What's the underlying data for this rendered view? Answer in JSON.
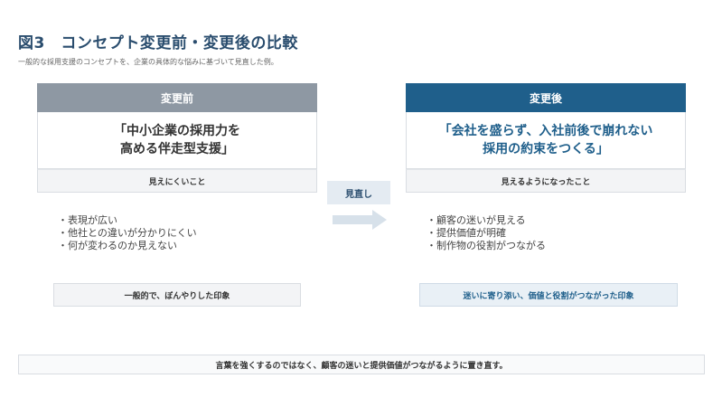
{
  "title": "図3　コンセプト変更前・変更後の比較",
  "subtitle": "一般的な採用支援のコンセプトを、企業の具体的な悩みに基づいて見直した例。",
  "before": {
    "header": "変更前",
    "concept_line1": "「中小企業の採用力を",
    "concept_line2": "高める伴走型支援」",
    "footer": "見えにくいこと",
    "bullets": [
      "・表現が広い",
      "・他社との違いが分かりにくい",
      "・何が変わるのか見えない"
    ],
    "summary": "一般的で、ぼんやりした印象"
  },
  "after": {
    "header": "変更後",
    "concept_line1": "「会社を盛らず、入社前後で崩れない",
    "concept_line2": "採用の約束をつくる」",
    "footer": "見えるようになったこと",
    "bullets": [
      "・顧客の迷いが見える",
      "・提供価値が明確",
      "・制作物の役割がつながる"
    ],
    "summary": "迷いに寄り添い、価値と役割がつながった印象"
  },
  "transition_label": "見直し",
  "footer_note": "言葉を強くするのではなく、顧客の迷いと提供価値がつながるように置き直す。",
  "colors": {
    "before_header": "#8e98a3",
    "after_header": "#1f5f8b",
    "title": "#2a4d6e"
  }
}
